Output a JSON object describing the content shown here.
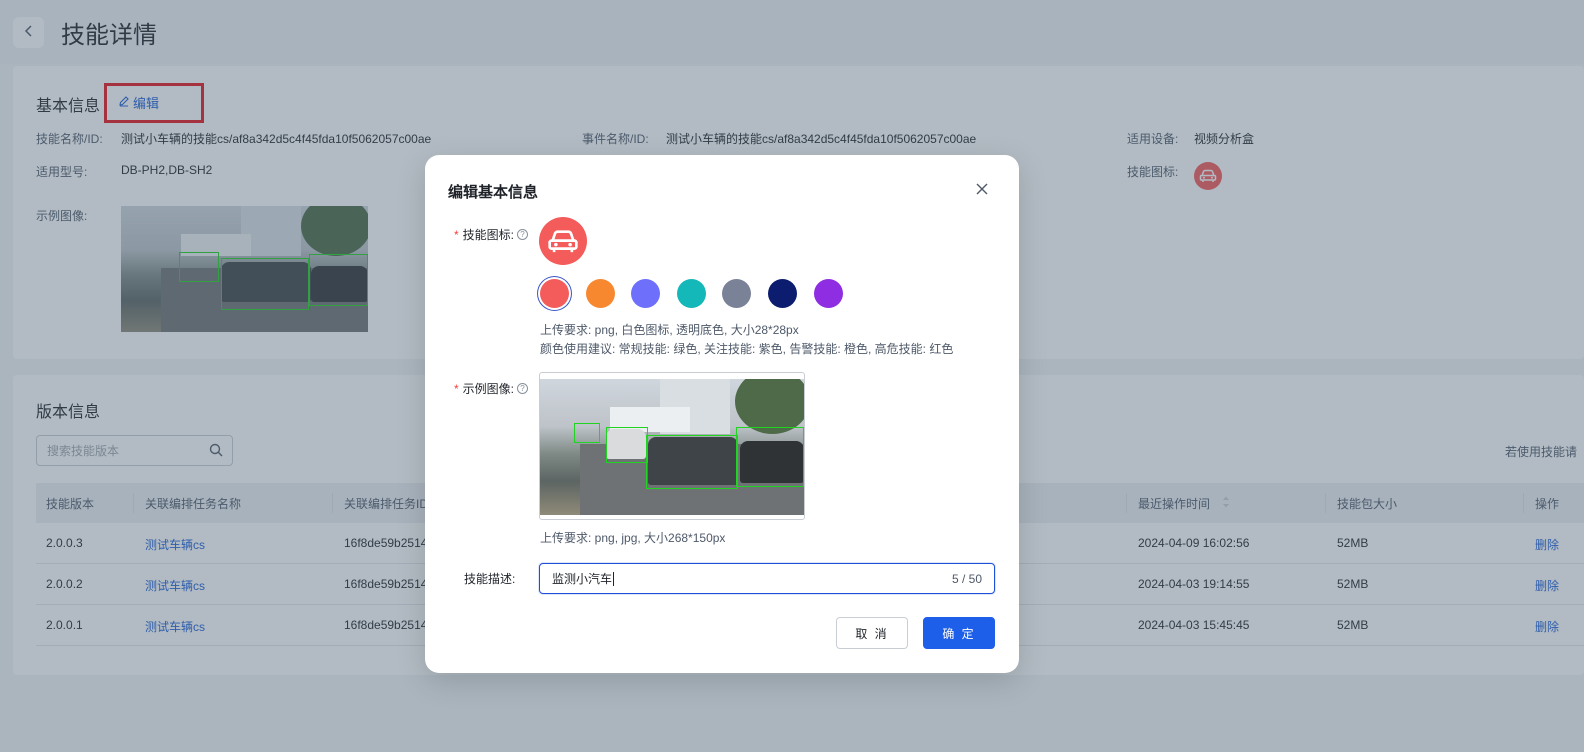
{
  "page": {
    "title": "技能详情",
    "back_icon": "chevron-left-icon"
  },
  "basic": {
    "section_title": "基本信息",
    "edit_label": "编辑",
    "fields": {
      "skill_name_label": "技能名称/ID:",
      "skill_name_value": "测试小车辆的技能cs/af8a342d5c4f45fda10f5062057c00ae",
      "event_name_label": "事件名称/ID:",
      "event_name_value": "测试小车辆的技能cs/af8a342d5c4f45fda10f5062057c00ae",
      "device_label": "适用设备:",
      "device_value": "视频分析盒",
      "model_label": "适用型号:",
      "model_value": "DB-PH2,DB-SH2",
      "icon_label": "技能图标:",
      "sample_label": "示例图像:"
    }
  },
  "version": {
    "section_title": "版本信息",
    "search_placeholder": "搜索技能版本",
    "right_hint": "若使用技能请",
    "columns": [
      "技能版本",
      "关联编排任务名称",
      "关联编排任务ID",
      "最近操作时间",
      "技能包大小",
      "操作"
    ],
    "rows": [
      {
        "version": "2.0.0.3",
        "task_name": "测试车辆cs",
        "task_id": "16f8de59b2514",
        "time": "2024-04-09 16:02:56",
        "size": "52MB",
        "action": "删除"
      },
      {
        "version": "2.0.0.2",
        "task_name": "测试车辆cs",
        "task_id": "16f8de59b2514",
        "time": "2024-04-03 19:14:55",
        "size": "52MB",
        "action": "删除"
      },
      {
        "version": "2.0.0.1",
        "task_name": "测试车辆cs",
        "task_id": "16f8de59b2514",
        "time": "2024-04-03 15:45:45",
        "size": "52MB",
        "action": "删除"
      }
    ]
  },
  "modal": {
    "title": "编辑基本信息",
    "icon_label": "技能图标:",
    "icon_colors": [
      "#f45b5b",
      "#f7882f",
      "#6e6ffb",
      "#14b8b8",
      "#7a8297",
      "#0c1c6e",
      "#8e2de2"
    ],
    "selected_color": "#f45b5b",
    "icon_hint_1": "上传要求: png, 白色图标, 透明底色, 大小28*28px",
    "icon_hint_2": "颜色使用建议: 常规技能: 绿色, 关注技能: 紫色, 告警技能: 橙色, 高危技能: 红色",
    "sample_label": "示例图像:",
    "sample_hint": "上传要求: png, jpg, 大小268*150px",
    "desc_label": "技能描述:",
    "desc_value": "监测小汽车",
    "desc_counter": "5 / 50",
    "cancel_label": "取 消",
    "ok_label": "确 定"
  }
}
